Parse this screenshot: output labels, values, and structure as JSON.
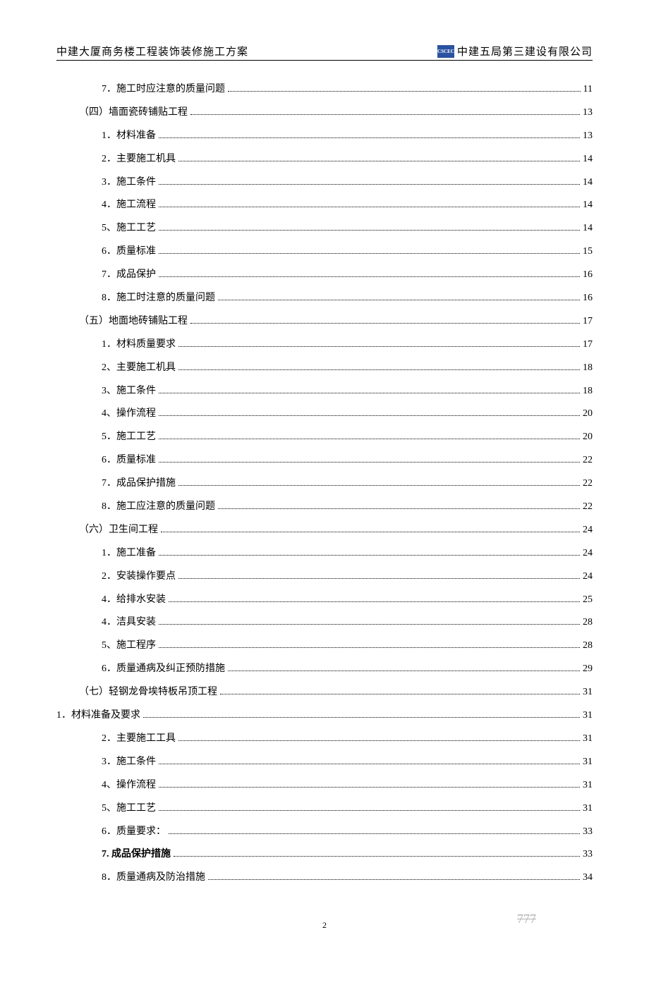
{
  "header": {
    "left": "中建大厦商务楼工程装饰装修施工方案",
    "right": "中建五局第三建设有限公司",
    "logo_text": "CSCEC"
  },
  "toc": [
    {
      "indent": 2,
      "label": "7．施工时应注意的质量问题",
      "page": "11",
      "bold": false
    },
    {
      "indent": 1,
      "label": "（四）墙面瓷砖铺贴工程",
      "page": "13",
      "bold": false
    },
    {
      "indent": 2,
      "label": "1．材料准备",
      "page": "13",
      "bold": false
    },
    {
      "indent": 2,
      "label": "2．主要施工机具",
      "page": "14",
      "bold": false
    },
    {
      "indent": 2,
      "label": "3．施工条件",
      "page": "14",
      "bold": false
    },
    {
      "indent": 2,
      "label": "4．施工流程",
      "page": "14",
      "bold": false
    },
    {
      "indent": 2,
      "label": "5、施工工艺",
      "page": "14",
      "bold": false
    },
    {
      "indent": 2,
      "label": "6．质量标准",
      "page": "15",
      "bold": false
    },
    {
      "indent": 2,
      "label": "7．成品保护",
      "page": "16",
      "bold": false
    },
    {
      "indent": 2,
      "label": "8．施工时注意的质量问题",
      "page": "16",
      "bold": false
    },
    {
      "indent": 1,
      "label": "（五）地面地砖铺贴工程",
      "page": "17",
      "bold": false
    },
    {
      "indent": 2,
      "label": "1．材料质量要求",
      "page": "17",
      "bold": false
    },
    {
      "indent": 2,
      "label": "2、主要施工机具",
      "page": "18",
      "bold": false
    },
    {
      "indent": 2,
      "label": "3、施工条件",
      "page": "18",
      "bold": false
    },
    {
      "indent": 2,
      "label": "4、操作流程",
      "page": "20",
      "bold": false
    },
    {
      "indent": 2,
      "label": "5．施工工艺",
      "page": "20",
      "bold": false
    },
    {
      "indent": 2,
      "label": "6．质量标准",
      "page": "22",
      "bold": false
    },
    {
      "indent": 2,
      "label": "7．成品保护措施",
      "page": "22",
      "bold": false
    },
    {
      "indent": 2,
      "label": "8．施工应注意的质量问题",
      "page": "22",
      "bold": false
    },
    {
      "indent": 1,
      "label": "（六）卫生间工程",
      "page": "24",
      "bold": false
    },
    {
      "indent": 2,
      "label": "1．施工准备",
      "page": "24",
      "bold": false
    },
    {
      "indent": 2,
      "label": "2．安装操作要点",
      "page": "24",
      "bold": false
    },
    {
      "indent": 2,
      "label": "4．给排水安装",
      "page": "25",
      "bold": false
    },
    {
      "indent": 2,
      "label": "4．洁具安装",
      "page": "28",
      "bold": false
    },
    {
      "indent": 2,
      "label": "5、施工程序",
      "page": "28",
      "bold": false
    },
    {
      "indent": 2,
      "label": "6．质量通病及纠正预防措施",
      "page": "29",
      "bold": false
    },
    {
      "indent": 1,
      "label": "（七）轻钢龙骨埃特板吊顶工程",
      "page": "31",
      "bold": false
    },
    {
      "indent": 0,
      "label": "1．材料准备及要求",
      "page": "31",
      "bold": false
    },
    {
      "indent": 2,
      "label": "2．主要施工工具",
      "page": "31",
      "bold": false
    },
    {
      "indent": 2,
      "label": "3．施工条件",
      "page": "31",
      "bold": false
    },
    {
      "indent": 2,
      "label": "4、操作流程",
      "page": "31",
      "bold": false
    },
    {
      "indent": 2,
      "label": "5、施工工艺",
      "page": "31",
      "bold": false
    },
    {
      "indent": 2,
      "label": "6．质量要求：",
      "page": "33",
      "bold": false
    },
    {
      "indent": 2,
      "label": "7. 成品保护措施",
      "page": "33",
      "bold": true
    },
    {
      "indent": 2,
      "label": "8．质量通病及防治措施",
      "page": "34",
      "bold": false
    }
  ],
  "page_number": "2",
  "footer_mark": "777"
}
